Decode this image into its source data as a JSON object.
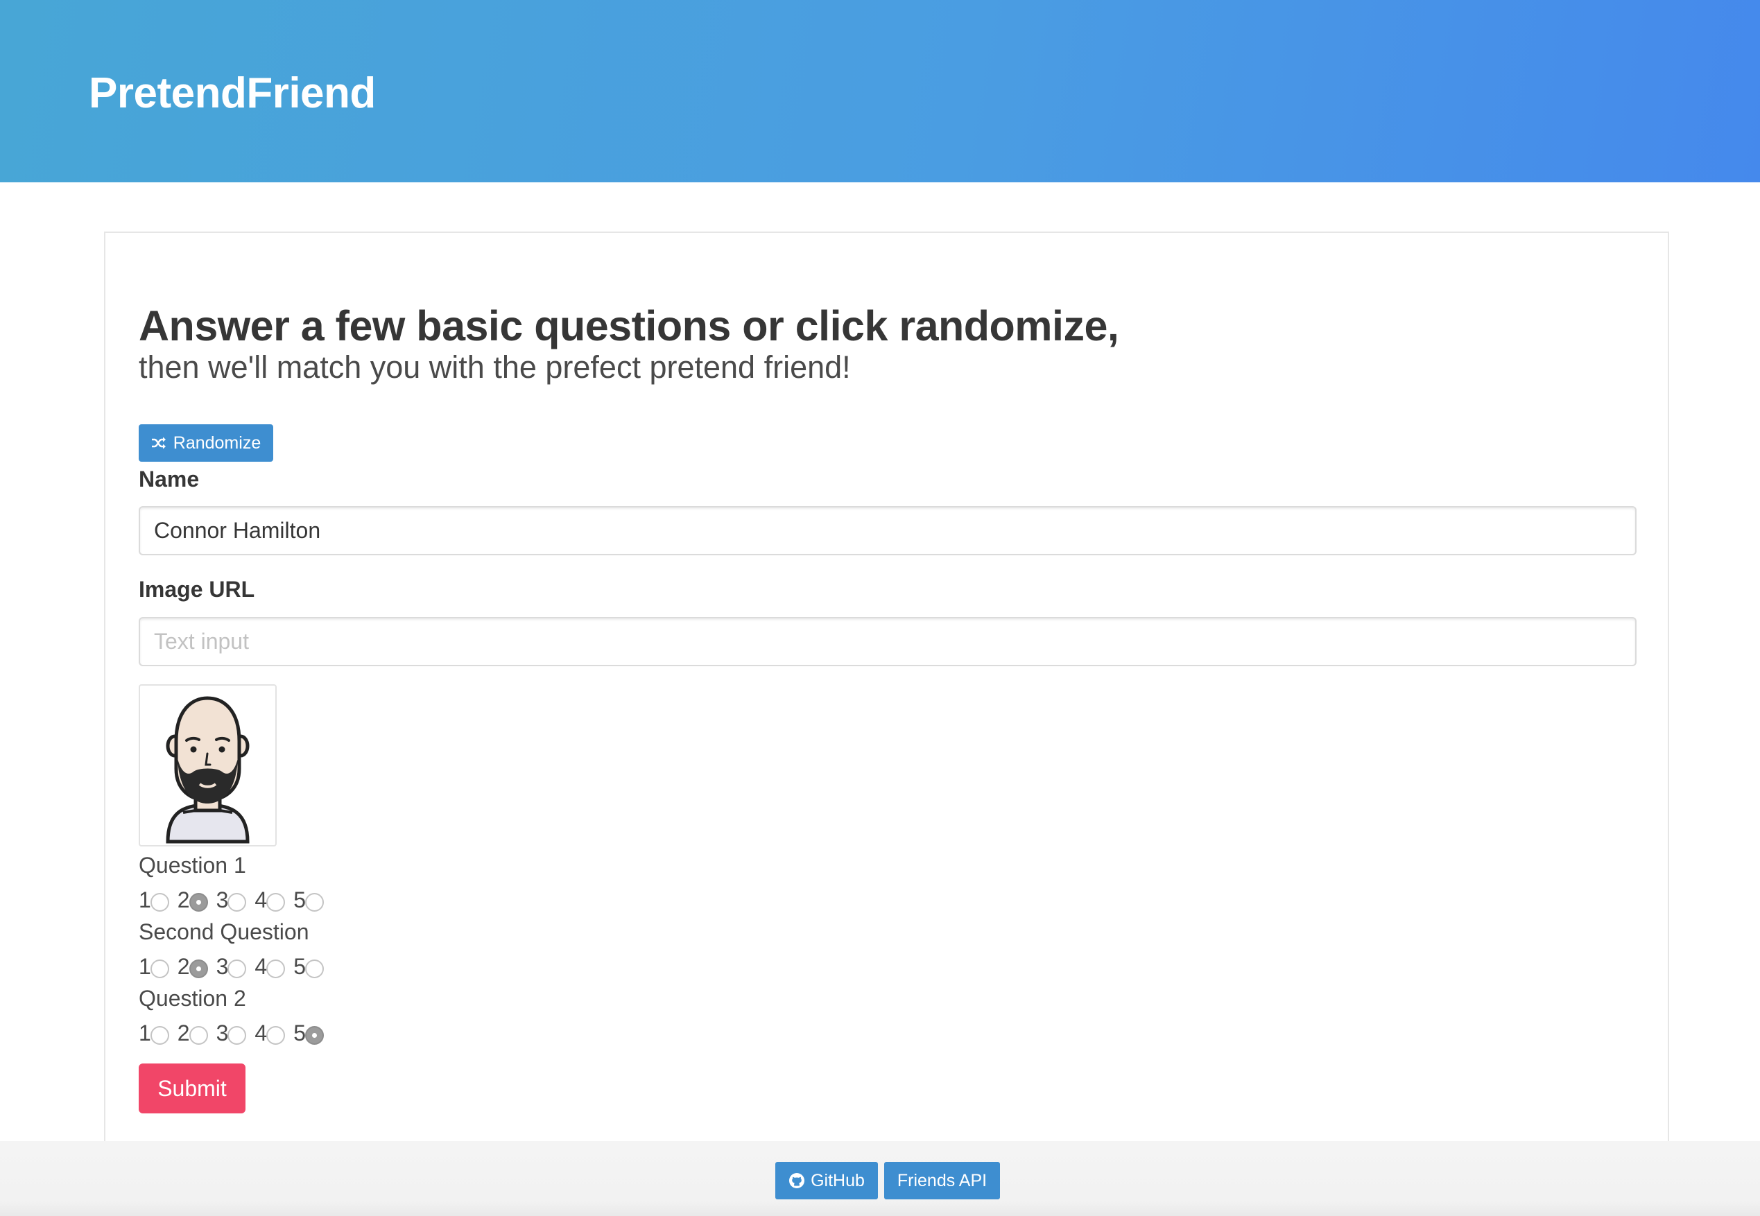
{
  "header": {
    "brand": "PretendFriend"
  },
  "form": {
    "title": "Answer a few basic questions or click randomize,",
    "subtitle": "then we'll match you with the prefect pretend friend!",
    "randomize_label": "Randomize",
    "name_label": "Name",
    "name_value": "Connor Hamilton",
    "image_label": "Image URL",
    "image_value": "",
    "image_placeholder": "Text input",
    "questions": [
      {
        "label": "Question 1",
        "options": [
          "1",
          "2",
          "3",
          "4",
          "5"
        ],
        "selected": "2"
      },
      {
        "label": "Second Question",
        "options": [
          "1",
          "2",
          "3",
          "4",
          "5"
        ],
        "selected": "2"
      },
      {
        "label": "Question 2",
        "options": [
          "1",
          "2",
          "3",
          "4",
          "5"
        ],
        "selected": "5"
      }
    ],
    "submit_label": "Submit"
  },
  "footer": {
    "github_label": "GitHub",
    "api_label": "Friends API"
  },
  "colors": {
    "header_gradient_start": "#48a6d6",
    "header_gradient_end": "#4589ec",
    "info_button": "#3e8ed0",
    "submit_button": "#f14668"
  },
  "icons": {
    "randomize": "shuffle-icon",
    "github": "github-icon"
  }
}
